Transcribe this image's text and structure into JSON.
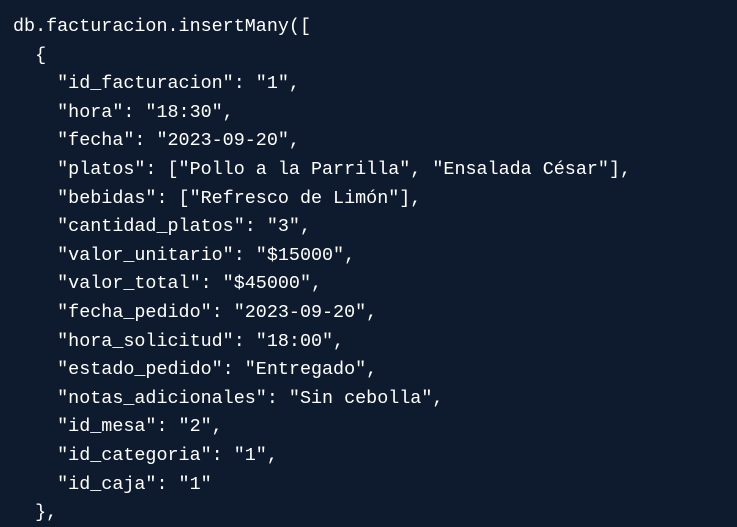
{
  "code": {
    "lines": [
      "db.facturacion.insertMany([",
      "  {",
      "    \"id_facturacion\": \"1\",",
      "    \"hora\": \"18:30\",",
      "    \"fecha\": \"2023-09-20\",",
      "    \"platos\": [\"Pollo a la Parrilla\", \"Ensalada César\"],",
      "    \"bebidas\": [\"Refresco de Limón\"],",
      "    \"cantidad_platos\": \"3\",",
      "    \"valor_unitario\": \"$15000\",",
      "    \"valor_total\": \"$45000\",",
      "    \"fecha_pedido\": \"2023-09-20\",",
      "    \"hora_solicitud\": \"18:00\",",
      "    \"estado_pedido\": \"Entregado\",",
      "    \"notas_adicionales\": \"Sin cebolla\",",
      "    \"id_mesa\": \"2\",",
      "    \"id_categoria\": \"1\",",
      "    \"id_caja\": \"1\"",
      "  },"
    ]
  },
  "colors": {
    "background": "#0e1b2f",
    "text": "#ffffff"
  }
}
